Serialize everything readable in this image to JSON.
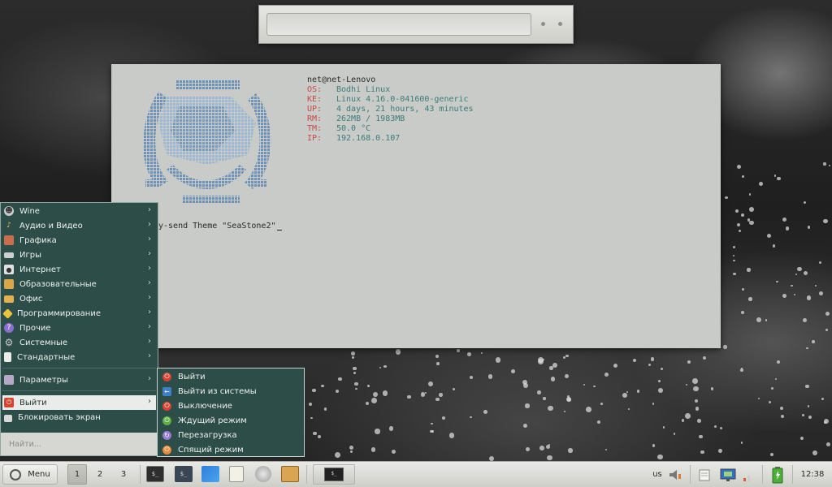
{
  "terminal": {
    "host": "net@net-Lenovo",
    "info": [
      {
        "key": "OS:",
        "value": "Bodhi Linux"
      },
      {
        "key": "KE:",
        "value": "Linux 4.16.0-041600-generic"
      },
      {
        "key": "UP:",
        "value": "4 days, 21 hours, 43 minutes"
      },
      {
        "key": "RM:",
        "value": "262MB / 1983MB"
      },
      {
        "key": "TM:",
        "value": "50.0 °C"
      },
      {
        "key": "IP:",
        "value": "192.168.0.107"
      }
    ],
    "command_text": "y-send Theme \"SeaStone2\""
  },
  "start_menu": {
    "categories": [
      {
        "label": "Wine",
        "icon": "wine-icon"
      },
      {
        "label": "Аудио и Видео",
        "icon": "music-icon"
      },
      {
        "label": "Графика",
        "icon": "graphics-icon"
      },
      {
        "label": "Игры",
        "icon": "games-icon"
      },
      {
        "label": "Интернет",
        "icon": "internet-icon"
      },
      {
        "label": "Образовательные",
        "icon": "folder-icon"
      },
      {
        "label": "Офис",
        "icon": "folder-icon"
      },
      {
        "label": "Программирование",
        "icon": "programming-icon"
      },
      {
        "label": "Прочие",
        "icon": "help-icon"
      },
      {
        "label": "Системные",
        "icon": "gear-icon"
      },
      {
        "label": "Стандартные",
        "icon": "document-icon"
      }
    ],
    "settings_label": "Параметры",
    "logout_label": "Выйти",
    "lock_label": "Блокировать экран",
    "search_placeholder": "Найти..."
  },
  "logout_submenu": [
    {
      "label": "Выйти",
      "color": "#d9422f"
    },
    {
      "label": "Выйти из системы",
      "color": "#3f7ec9"
    },
    {
      "label": "Выключение",
      "color": "#d9422f"
    },
    {
      "label": "Ждущий режим",
      "color": "#5fb043"
    },
    {
      "label": "Перезагрузка",
      "color": "#9b7bd1"
    },
    {
      "label": "Спящий режим",
      "color": "#e88a3b"
    }
  ],
  "taskbar": {
    "menu_label": "Menu",
    "workspaces": [
      "1",
      "2",
      "3"
    ],
    "active_workspace": "1",
    "keyboard_layout": "us",
    "clock": "12:38"
  },
  "colors": {
    "menu_bg": "#2d4d49",
    "terminal_bg": "#c9cbc8",
    "key_color": "#c84a4a",
    "value_color": "#3c7c78"
  }
}
